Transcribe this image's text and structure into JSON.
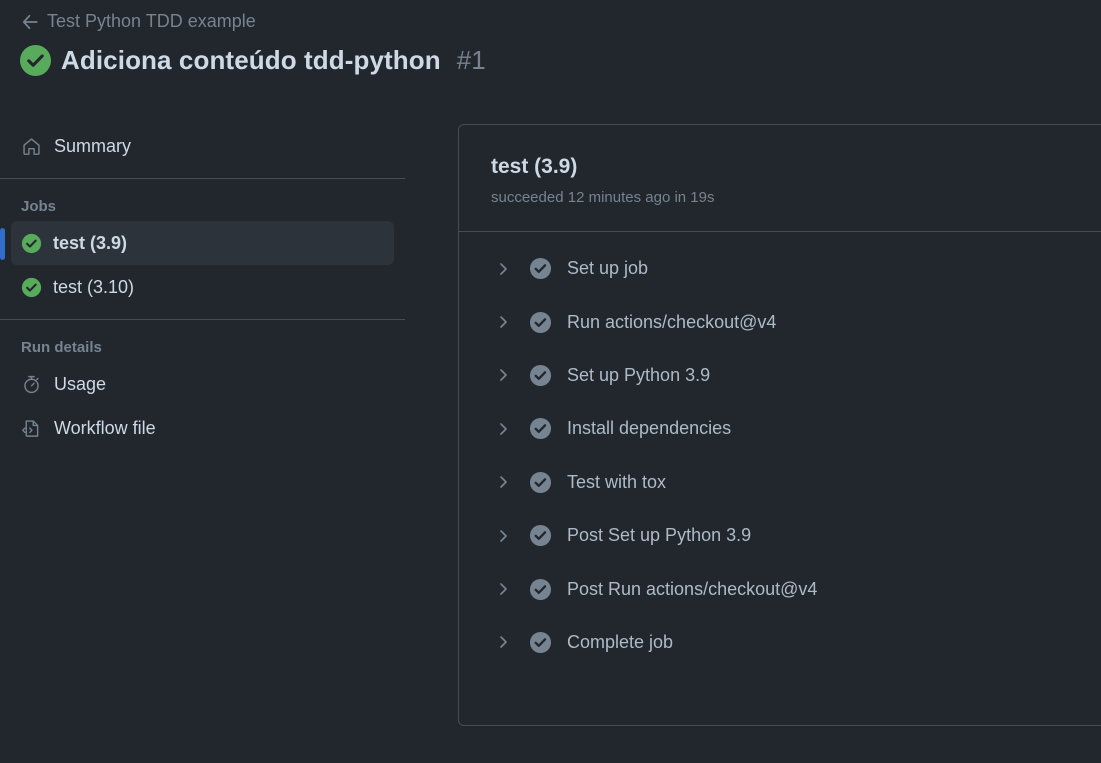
{
  "header": {
    "back_label": "Test Python TDD example",
    "title": "Adiciona conteúdo tdd-python",
    "run_number": "#1"
  },
  "sidebar": {
    "summary_label": "Summary",
    "jobs_heading": "Jobs",
    "jobs": [
      {
        "label": "test (3.9)",
        "status": "success",
        "active": true
      },
      {
        "label": "test (3.10)",
        "status": "success",
        "active": false
      }
    ],
    "run_details_heading": "Run details",
    "usage_label": "Usage",
    "workflow_file_label": "Workflow file"
  },
  "job_panel": {
    "title": "test (3.9)",
    "subtitle": "succeeded 12 minutes ago in 19s",
    "steps": [
      {
        "label": "Set up job"
      },
      {
        "label": "Run actions/checkout@v4"
      },
      {
        "label": "Set up Python 3.9"
      },
      {
        "label": "Install dependencies"
      },
      {
        "label": "Test with tox"
      },
      {
        "label": "Post Set up Python 3.9"
      },
      {
        "label": "Post Run actions/checkout@v4"
      },
      {
        "label": "Complete job"
      }
    ]
  },
  "icons": {
    "back": "arrow-left-icon",
    "status": "check-circle-fill-icon",
    "summary": "home-icon",
    "usage": "stopwatch-icon",
    "workflow_file": "file-code-icon",
    "step_expand": "chevron-right-icon",
    "step_status": "check-circle-fill-icon"
  },
  "colors": {
    "background": "#22272e",
    "success": "#57ab5a",
    "step_check": "#768390",
    "active_indicator": "#316dca",
    "active_bg": "#2d333b",
    "border": "#444c56"
  }
}
